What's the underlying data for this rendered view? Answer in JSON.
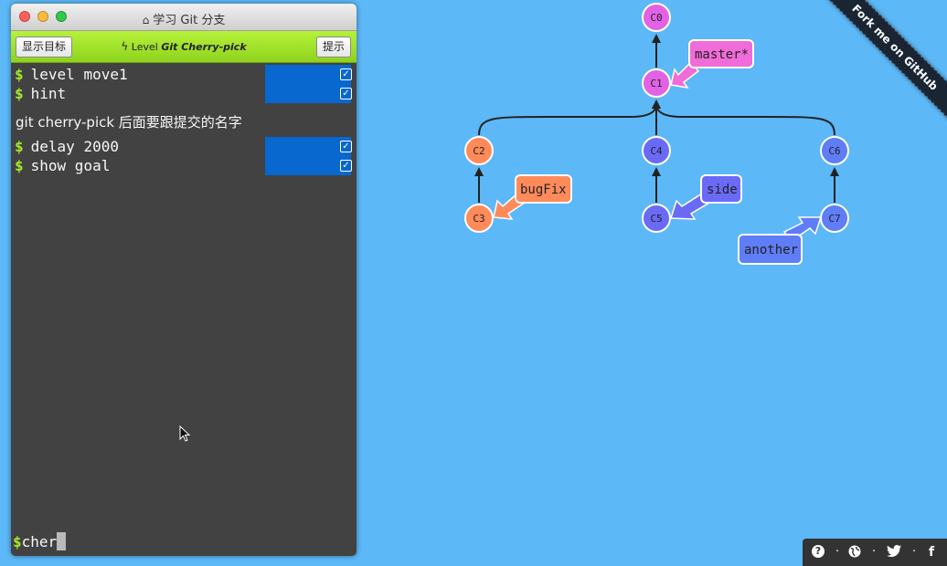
{
  "window": {
    "title": "学习 Git 分支",
    "show_goal_button": "显示目标",
    "hint_button": "提示",
    "level_prefix": "Level",
    "level_name": "Git Cherry-pick"
  },
  "terminal": {
    "commands_top": [
      {
        "prompt": "$",
        "text": "level move1",
        "status": "done"
      },
      {
        "prompt": "$",
        "text": "hint",
        "status": "done"
      }
    ],
    "hint_message": "git cherry-pick 后面要跟提交的名字",
    "commands_bottom": [
      {
        "prompt": "$",
        "text": "delay 2000",
        "status": "done"
      },
      {
        "prompt": "$",
        "text": "show goal",
        "status": "done"
      }
    ],
    "input_prompt": "$",
    "input_value": "cher"
  },
  "graph": {
    "commits": [
      {
        "id": "C0",
        "color": "#e262e6"
      },
      {
        "id": "C1",
        "color": "#e262e6"
      },
      {
        "id": "C2",
        "color": "#ff8a5a"
      },
      {
        "id": "C3",
        "color": "#ff8a5a"
      },
      {
        "id": "C4",
        "color": "#6a6af6"
      },
      {
        "id": "C5",
        "color": "#6a6af6"
      },
      {
        "id": "C6",
        "color": "#5f7df6"
      },
      {
        "id": "C7",
        "color": "#5f7df6"
      }
    ],
    "branches": [
      {
        "name": "master*",
        "target": "C1",
        "color": "#f06cd8"
      },
      {
        "name": "bugFix",
        "target": "C3",
        "color": "#ff8a5a"
      },
      {
        "name": "side",
        "target": "C5",
        "color": "#6a6af6"
      },
      {
        "name": "another",
        "target": "C7",
        "color": "#5f7df6"
      }
    ]
  },
  "ribbon": {
    "text": "Fork me on GitHub"
  },
  "footer": {
    "icons": [
      "help-icon",
      "globe-icon",
      "twitter-icon",
      "facebook-icon"
    ],
    "help": "?",
    "separator": "·",
    "facebook": "f"
  }
}
